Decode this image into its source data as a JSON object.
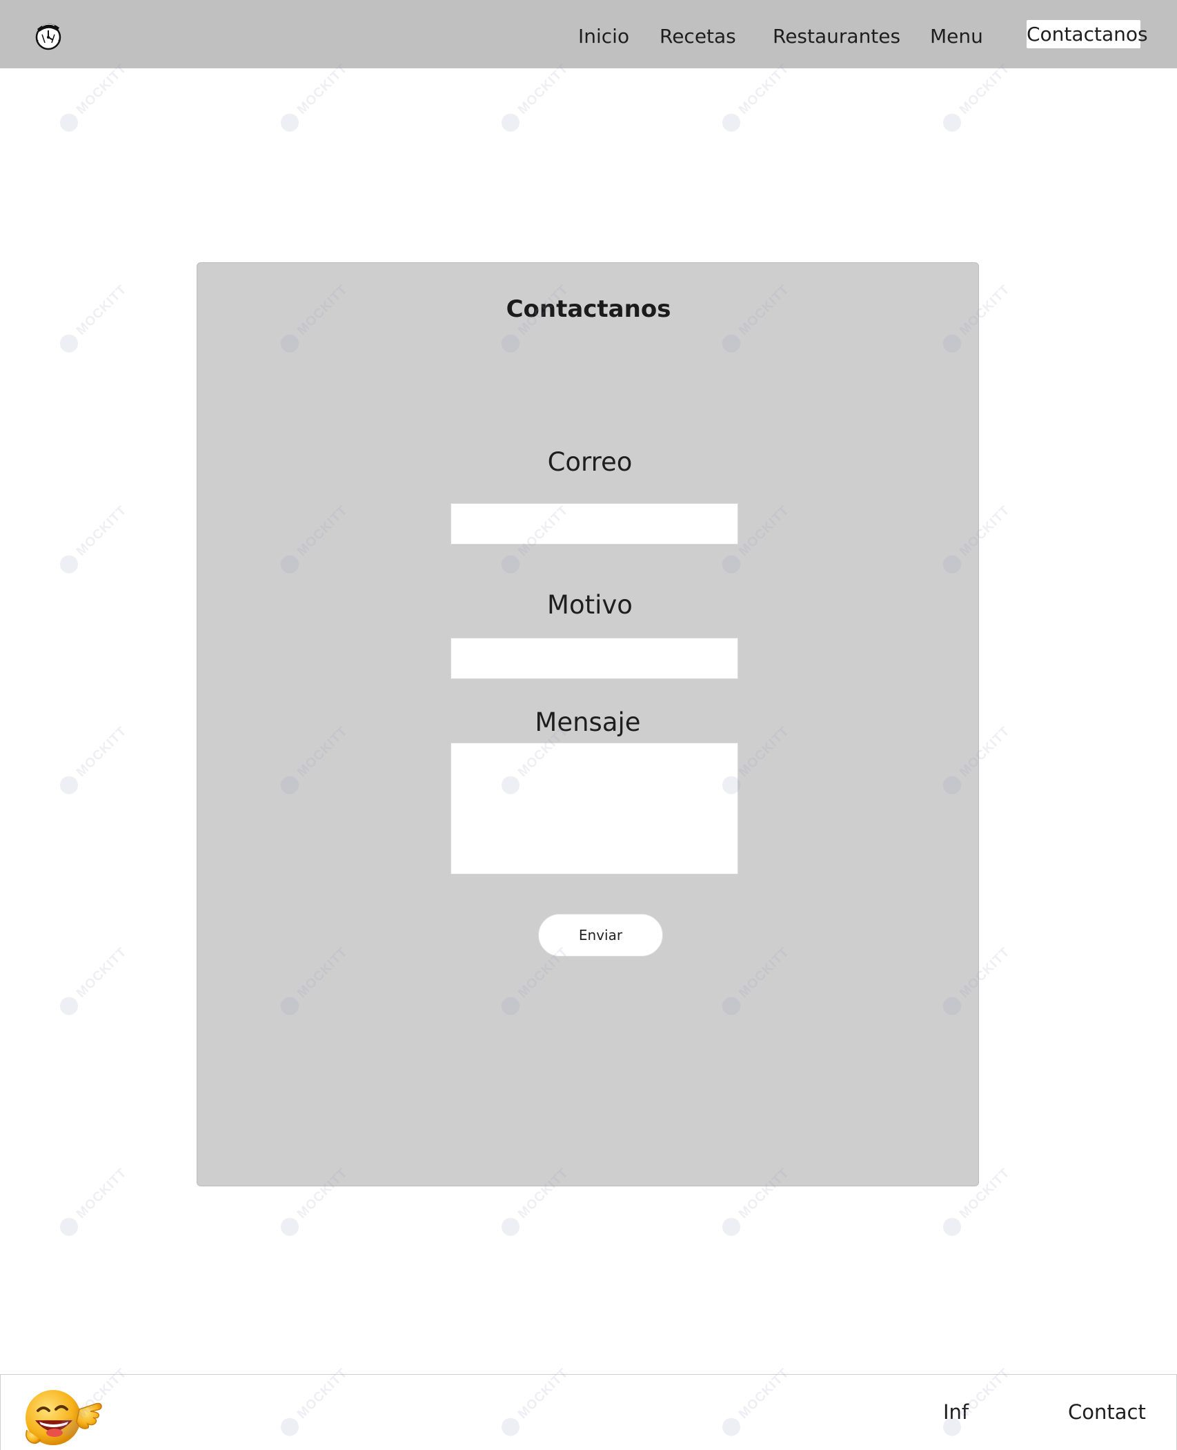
{
  "nav": {
    "items": [
      {
        "label": "Inicio"
      },
      {
        "label": "Recetas"
      },
      {
        "label": "Restaurantes"
      },
      {
        "label": "Menu"
      }
    ],
    "active_label": "Contactanos"
  },
  "form": {
    "title": "Contactanos",
    "fields": {
      "correo": {
        "label": "Correo",
        "value": ""
      },
      "motivo": {
        "label": "Motivo",
        "value": ""
      },
      "mensaje": {
        "label": "Mensaje",
        "value": ""
      }
    },
    "submit_label": "Enviar"
  },
  "footer": {
    "links": [
      {
        "label": "Inf"
      },
      {
        "label": "Contact"
      }
    ]
  },
  "watermark": "MOCKITT",
  "colors": {
    "header_bg": "#c0c0c0",
    "card_bg": "#cecece",
    "page_bg": "#ffffff"
  }
}
